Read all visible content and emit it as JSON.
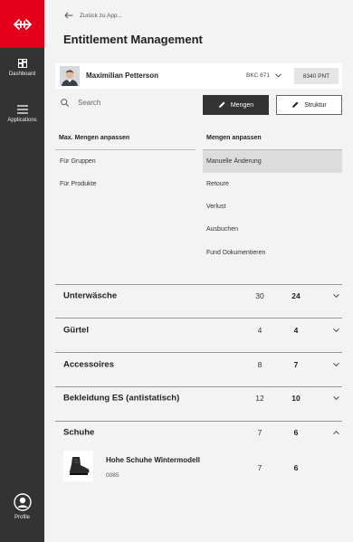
{
  "sidebar": {
    "dashboard_label": "Dashboard",
    "applications_label": "Applications",
    "profile_label": "Profile",
    "brand_color": "#e4001b"
  },
  "header": {
    "back_label": "Zurück zu App...",
    "title": "Entitlement Management"
  },
  "user": {
    "name": "Maximilian Petterson",
    "account": "BKC 671",
    "points": "8340 PNT"
  },
  "search": {
    "placeholder": "Search"
  },
  "toggle": {
    "mengen_label": "Mengen",
    "struktur_label": "Struktur",
    "active": "Mengen"
  },
  "menu": {
    "left_heading": "Max. Mengen anpassen",
    "left_items": [
      "Für Gruppen",
      "Für Produkte"
    ],
    "right_heading": "Mengen anpassen",
    "right_items": [
      "Manuelle Änderung",
      "Retoure",
      "Verlust",
      "Ausbuchen",
      "Fund Dokumentieren"
    ],
    "right_active": "Manuelle Änderung"
  },
  "categories": [
    {
      "name": "Unterwäsche",
      "a": "30",
      "b": "24",
      "expanded": false
    },
    {
      "name": "Gürtel",
      "a": "4",
      "b": "4",
      "expanded": false
    },
    {
      "name": "Accessoires",
      "a": "8",
      "b": "7",
      "expanded": false
    },
    {
      "name": "Bekleidung ES (antistatisch)",
      "a": "12",
      "b": "10",
      "expanded": false
    },
    {
      "name": "Schuhe",
      "a": "7",
      "b": "6",
      "expanded": true
    }
  ],
  "product": {
    "name": "Hohe Schuhe Wintermodell",
    "code": "0085",
    "a": "7",
    "b": "6"
  }
}
